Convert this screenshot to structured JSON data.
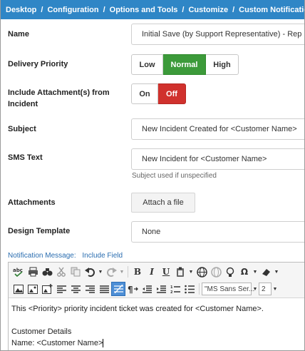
{
  "breadcrumb": [
    "Desktop",
    "Configuration",
    "Options and Tools",
    "Customize",
    "Custom Notifications"
  ],
  "breadcrumb_separator": "/",
  "form": {
    "name": {
      "label": "Name",
      "value": "Initial Save (by Support Representative) - Rep"
    },
    "delivery_priority": {
      "label": "Delivery Priority",
      "options": [
        "Low",
        "Normal",
        "High"
      ],
      "selected": "Normal"
    },
    "include_attachments": {
      "label_line1": "Include Attachment(s) from",
      "label_line2": "Incident",
      "options": [
        "On",
        "Off"
      ],
      "selected": "Off"
    },
    "subject": {
      "label": "Subject",
      "value": "New Incident Created for <Customer Name>"
    },
    "sms_text": {
      "label": "SMS Text",
      "value": "New Incident for <Customer Name>",
      "hint": "Subject used if unspecified"
    },
    "attachments": {
      "label": "Attachments",
      "button": "Attach a file"
    },
    "design_template": {
      "label": "Design Template",
      "value": "None"
    }
  },
  "notification": {
    "label": "Notification Message:",
    "include_field_link": "Include Field"
  },
  "toolbar": {
    "row1": [
      "spellcheck-icon",
      "print-icon",
      "find-icon",
      "cut-icon",
      "copy-icon",
      "undo-icon",
      "redo-icon",
      "bold-icon",
      "italic-icon",
      "underline-icon",
      "paste-icon",
      "link-icon",
      "unlink-icon",
      "lightbulb-icon",
      "special-char-icon",
      "eraser-icon"
    ],
    "glyphs": {
      "bold": "B",
      "italic": "I",
      "underline": "U",
      "omega": "Ω"
    },
    "font_name": "\"MS Sans Ser...",
    "font_size": "2",
    "active_button": "table-icon",
    "accent_color": "#2f86c6"
  },
  "editor_content": {
    "line1": "This <Priority> priority incident ticket was created for <Customer Name>.",
    "line2": "Customer Details",
    "line3": "Name: <Customer Name>"
  }
}
